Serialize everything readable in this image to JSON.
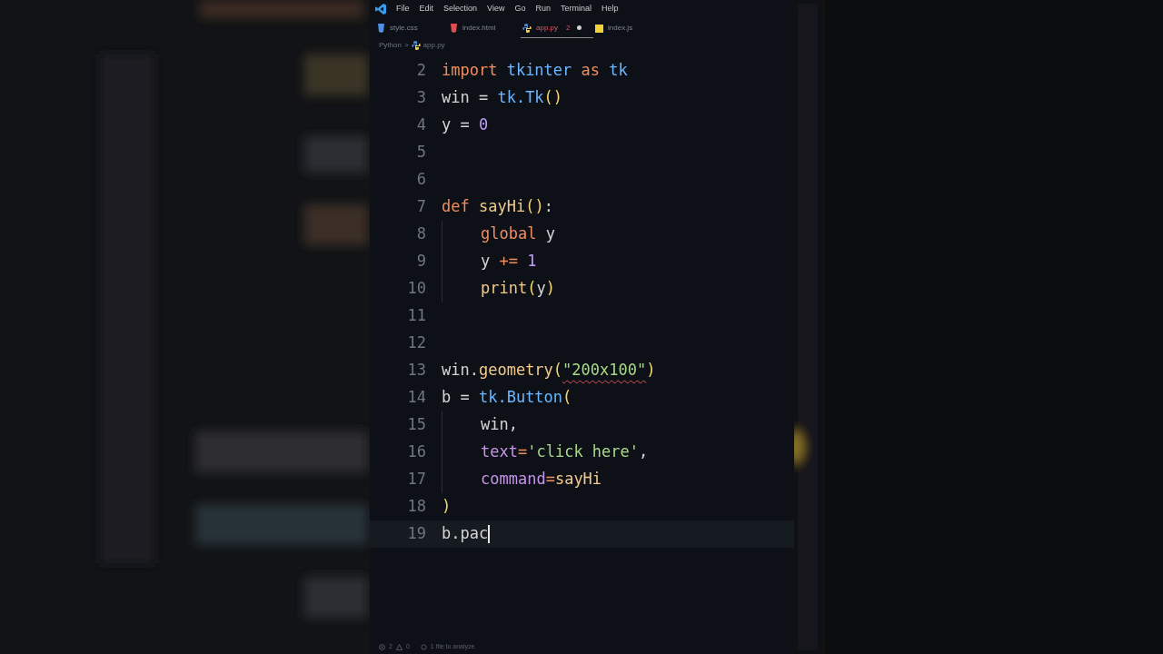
{
  "menu": [
    "File",
    "Edit",
    "Selection",
    "View",
    "Go",
    "Run",
    "Terminal",
    "Help"
  ],
  "tabs": [
    {
      "label": "style.css",
      "kind": "css",
      "selected": false
    },
    {
      "label": "index.html",
      "kind": "html",
      "selected": false
    },
    {
      "label": "app.py",
      "kind": "python",
      "selected": true,
      "problems": "2",
      "modified": true
    },
    {
      "label": "index.js",
      "kind": "js",
      "selected": false
    }
  ],
  "breadcrumb": {
    "folder": "Python",
    "separator": ">",
    "file": "app.py"
  },
  "lines": [
    {
      "number": "2",
      "current": false,
      "tokens": [
        {
          "text": "import ",
          "kind": "keyword"
        },
        {
          "text": "tkinter ",
          "kind": "name"
        },
        {
          "text": "as ",
          "kind": "keyword"
        },
        {
          "text": "tk",
          "kind": "name"
        }
      ]
    },
    {
      "number": "3",
      "current": false,
      "tokens": [
        {
          "text": "win = ",
          "kind": "plain"
        },
        {
          "text": "tk.Tk",
          "kind": "name"
        },
        {
          "text": "()",
          "kind": "paren"
        }
      ]
    },
    {
      "number": "4",
      "current": false,
      "tokens": [
        {
          "text": "y = ",
          "kind": "plain"
        },
        {
          "text": "0",
          "kind": "number"
        }
      ]
    },
    {
      "number": "5",
      "current": false
    },
    {
      "number": "6",
      "current": false
    },
    {
      "number": "7",
      "current": false,
      "tokens": [
        {
          "text": "def ",
          "kind": "keyword"
        },
        {
          "text": "sayHi",
          "kind": "func"
        },
        {
          "text": "()",
          "kind": "paren"
        },
        {
          "text": ":",
          "kind": "plain"
        }
      ],
      "children": [
        {
          "number": "8",
          "current": false,
          "tokens": [
            {
              "text": "global ",
              "kind": "keyword"
            },
            {
              "text": "y",
              "kind": "plain"
            }
          ]
        },
        {
          "number": "9",
          "current": false,
          "tokens": [
            {
              "text": "y ",
              "kind": "plain"
            },
            {
              "text": "+=",
              "kind": "keyword"
            },
            {
              "text": " 1",
              "kind": "number"
            }
          ]
        },
        {
          "number": "10",
          "current": false,
          "tokens": [
            {
              "text": "print",
              "kind": "func"
            },
            {
              "text": "(",
              "kind": "paren"
            },
            {
              "text": "y",
              "kind": "plain"
            },
            {
              "text": ")",
              "kind": "paren"
            }
          ]
        }
      ]
    },
    {
      "number": "11",
      "current": false
    },
    {
      "number": "12",
      "current": false
    },
    {
      "number": "13",
      "current": false,
      "tokens": [
        {
          "text": "win.",
          "kind": "plain"
        },
        {
          "text": "geometry",
          "kind": "func"
        },
        {
          "text": "(",
          "kind": "paren"
        },
        {
          "text": "\"200x100\"",
          "kind": "string",
          "squiggle": true
        },
        {
          "text": ")",
          "kind": "paren"
        }
      ]
    },
    {
      "number": "14",
      "current": false,
      "tokens": [
        {
          "text": "b = ",
          "kind": "plain"
        },
        {
          "text": "tk.Button",
          "kind": "name"
        },
        {
          "text": "(",
          "kind": "paren"
        }
      ],
      "children": [
        {
          "number": "15",
          "current": false,
          "tokens": [
            {
              "text": "win,",
              "kind": "plain"
            }
          ]
        },
        {
          "number": "16",
          "current": false,
          "tokens": [
            {
              "text": "text",
              "kind": "param"
            },
            {
              "text": "=",
              "kind": "keyword"
            },
            {
              "text": "'click here'",
              "kind": "string"
            },
            {
              "text": ",",
              "kind": "plain"
            }
          ]
        },
        {
          "number": "17",
          "current": false,
          "tokens": [
            {
              "text": "command",
              "kind": "param"
            },
            {
              "text": "=",
              "kind": "keyword"
            },
            {
              "text": "sayHi",
              "kind": "func"
            }
          ]
        }
      ]
    },
    {
      "number": "18",
      "current": false,
      "tokens": [
        {
          "text": ")",
          "kind": "paren"
        }
      ]
    },
    {
      "number": "19",
      "current": true,
      "tokens": [
        {
          "text": "b.pac",
          "kind": "plain"
        }
      ]
    }
  ],
  "status": {
    "errors": "2",
    "warnings": "0",
    "analysis": "1 file to analyze"
  }
}
